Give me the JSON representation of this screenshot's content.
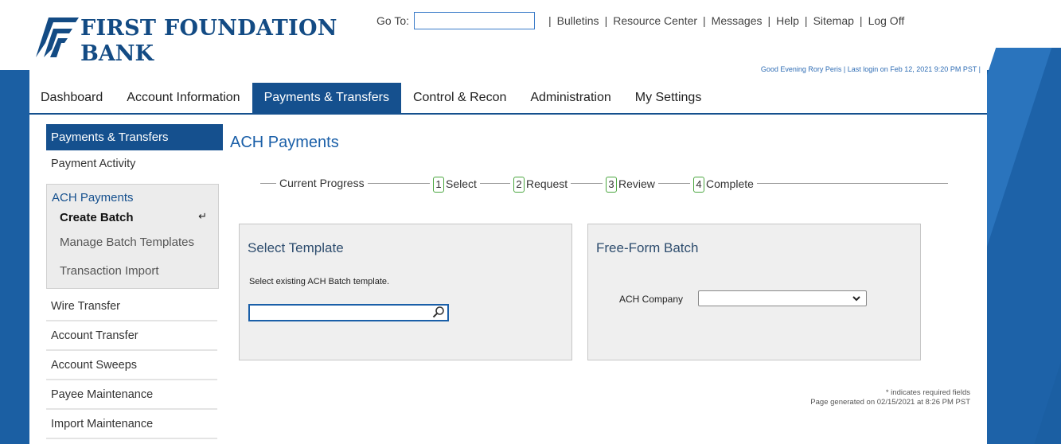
{
  "header": {
    "bank_name_line1": "FIRST FOUNDATION",
    "bank_name_line2": "BANK",
    "goto_label": "Go To:",
    "goto_value": "",
    "links": [
      "Bulletins",
      "Resource Center",
      "Messages",
      "Help",
      "Sitemap",
      "Log Off"
    ],
    "greeting": "Good Evening Rory Peris | Last login on Feb 12, 2021 9:20 PM PST |"
  },
  "nav": {
    "items": [
      "Dashboard",
      "Account Information",
      "Payments & Transfers",
      "Control & Recon",
      "Administration",
      "My Settings"
    ],
    "active": "Payments & Transfers"
  },
  "sidebar": {
    "header": "Payments & Transfers",
    "payment_activity": "Payment Activity",
    "group_title": "ACH Payments",
    "group_items": [
      "Create Batch",
      "Manage Batch Templates",
      "Transaction Import"
    ],
    "current_item": "Create Batch",
    "items": [
      "Wire Transfer",
      "Account Transfer",
      "Account Sweeps",
      "Payee Maintenance",
      "Import Maintenance"
    ]
  },
  "main": {
    "title": "ACH Payments",
    "progress": {
      "label": "Current Progress",
      "steps": [
        {
          "num": "1",
          "label": "Select"
        },
        {
          "num": "2",
          "label": "Request"
        },
        {
          "num": "3",
          "label": "Review"
        },
        {
          "num": "4",
          "label": "Complete"
        }
      ]
    },
    "select_template": {
      "title": "Select Template",
      "hint": "Select existing ACH Batch template.",
      "value": ""
    },
    "free_form": {
      "title": "Free-Form Batch",
      "company_label": "ACH Company",
      "company_value": ""
    },
    "footnote_required": "* indicates required fields",
    "footnote_generated": "Page generated on 02/15/2021 at 8:26 PM PST"
  },
  "colors": {
    "brand_blue": "#15508e",
    "link_blue": "#1a5fa8",
    "step_green": "#4aa63f"
  },
  "icons": {
    "search": "magnifier-icon",
    "return": "return-arrow-icon",
    "dropdown": "chevron-down-icon"
  }
}
